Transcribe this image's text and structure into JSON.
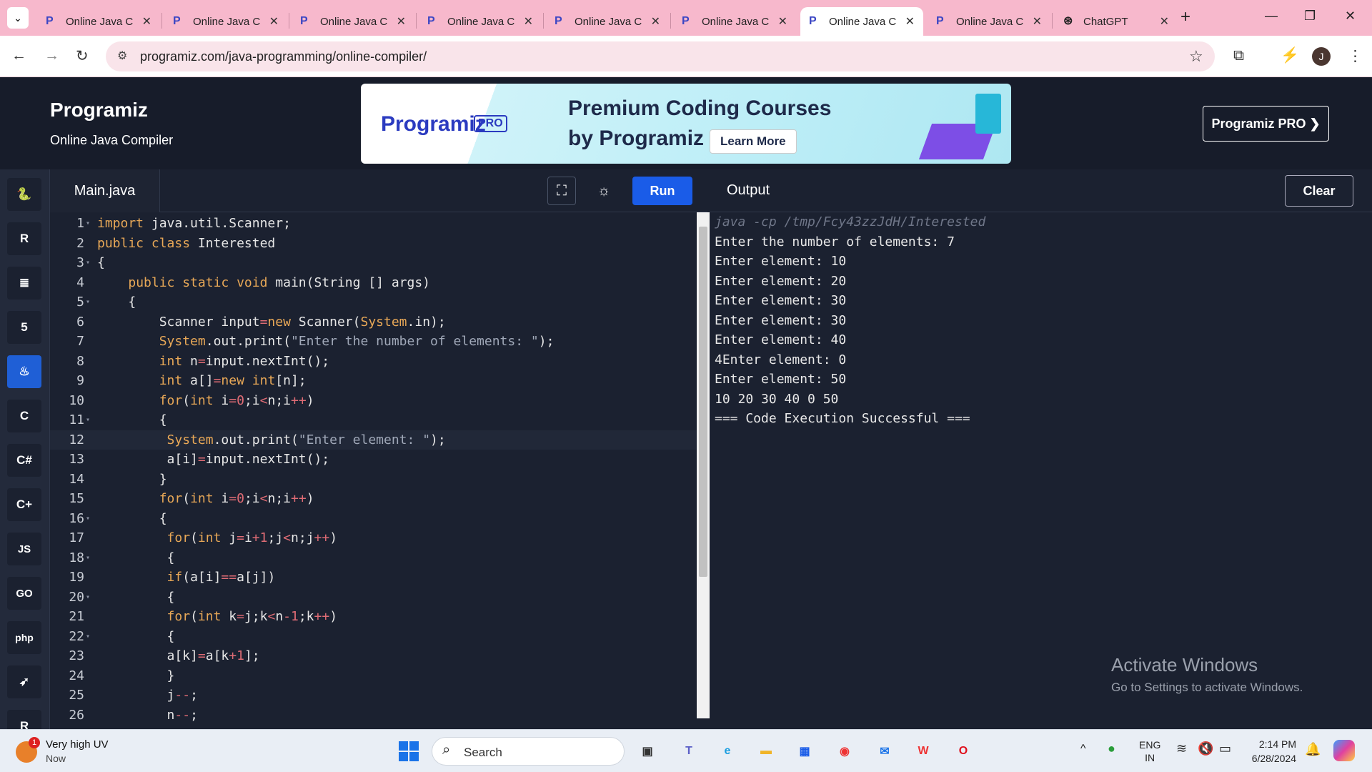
{
  "browser": {
    "tabs": [
      {
        "title": "Online Java C",
        "active": false
      },
      {
        "title": "Online Java C",
        "active": false
      },
      {
        "title": "Online Java C",
        "active": false
      },
      {
        "title": "Online Java C",
        "active": false
      },
      {
        "title": "Online Java C",
        "active": false
      },
      {
        "title": "Online Java C",
        "active": false
      },
      {
        "title": "Online Java C",
        "active": true
      },
      {
        "title": "Online Java C",
        "active": false
      },
      {
        "title": "ChatGPT",
        "active": false
      }
    ],
    "url": "programiz.com/java-programming/online-compiler/",
    "profile_initial": "J"
  },
  "site": {
    "logo": "Programiz",
    "subtitle": "Online Java Compiler",
    "banner": {
      "logo": "Programiz",
      "badge": "PRO",
      "line1": "Premium Coding Courses",
      "line2": "by Programiz",
      "cta": "Learn More"
    },
    "pro_button": "Programiz PRO ❯"
  },
  "sidebar": {
    "languages": [
      {
        "name": "python-icon",
        "glyph": "🐍",
        "active": false
      },
      {
        "name": "r-icon",
        "glyph": "R",
        "active": false
      },
      {
        "name": "sql-icon",
        "glyph": "≣",
        "active": false
      },
      {
        "name": "html-icon",
        "glyph": "5",
        "active": false
      },
      {
        "name": "java-icon",
        "glyph": "♨",
        "active": true
      },
      {
        "name": "c-icon",
        "glyph": "C",
        "active": false
      },
      {
        "name": "csharp-icon",
        "glyph": "C#",
        "active": false
      },
      {
        "name": "cpp-icon",
        "glyph": "C+",
        "active": false
      },
      {
        "name": "js-icon",
        "glyph": "JS",
        "active": false
      },
      {
        "name": "go-icon",
        "glyph": "GO",
        "active": false
      },
      {
        "name": "php-icon",
        "glyph": "php",
        "active": false
      },
      {
        "name": "swift-icon",
        "glyph": "➶",
        "active": false
      },
      {
        "name": "rust-icon",
        "glyph": "R",
        "active": false
      }
    ]
  },
  "editor": {
    "file_tab": "Main.java",
    "run_label": "Run",
    "current_line": 12,
    "lines": [
      {
        "n": "1",
        "fold": true,
        "html": "<span class='kw'>import</span> java.util.Scanner;"
      },
      {
        "n": "2",
        "fold": false,
        "html": "<span class='kw'>public class</span> Interested"
      },
      {
        "n": "3",
        "fold": true,
        "html": "{"
      },
      {
        "n": "4",
        "fold": false,
        "html": "    <span class='kw'>public static void</span> main(String [] args)"
      },
      {
        "n": "5",
        "fold": true,
        "html": "    {"
      },
      {
        "n": "6",
        "fold": false,
        "html": "        Scanner input<span class='op'>=</span><span class='kw'>new</span> Scanner(<span class='kw'>System</span>.in);"
      },
      {
        "n": "7",
        "fold": false,
        "html": "        <span class='kw'>System</span>.out.print(<span class='str'>\"Enter the number of elements: \"</span>);"
      },
      {
        "n": "8",
        "fold": false,
        "html": "        <span class='kw'>int</span> n<span class='op'>=</span>input.nextInt();"
      },
      {
        "n": "9",
        "fold": false,
        "html": "        <span class='kw'>int</span> a[]<span class='op'>=</span><span class='kw'>new int</span>[n];"
      },
      {
        "n": "10",
        "fold": false,
        "html": "        <span class='kw'>for</span>(<span class='kw'>int</span> i<span class='op'>=</span><span class='num'>0</span>;i<span class='op'>&lt;</span>n;i<span class='op'>++</span>)"
      },
      {
        "n": "11",
        "fold": true,
        "html": "        {"
      },
      {
        "n": "12",
        "fold": false,
        "html": "         <span class='kw'>System</span>.out.print(<span class='str'>\"Enter element: \"</span>);"
      },
      {
        "n": "13",
        "fold": false,
        "html": "         a[i]<span class='op'>=</span>input.nextInt();"
      },
      {
        "n": "14",
        "fold": false,
        "html": "        }"
      },
      {
        "n": "15",
        "fold": false,
        "html": "        <span class='kw'>for</span>(<span class='kw'>int</span> i<span class='op'>=</span><span class='num'>0</span>;i<span class='op'>&lt;</span>n;i<span class='op'>++</span>)"
      },
      {
        "n": "16",
        "fold": true,
        "html": "        {"
      },
      {
        "n": "17",
        "fold": false,
        "html": "         <span class='kw'>for</span>(<span class='kw'>int</span> j<span class='op'>=</span>i<span class='op'>+</span><span class='num'>1</span>;j<span class='op'>&lt;</span>n;j<span class='op'>++</span>)"
      },
      {
        "n": "18",
        "fold": true,
        "html": "         {"
      },
      {
        "n": "19",
        "fold": false,
        "html": "         <span class='kw'>if</span>(a[i]<span class='op'>==</span>a[j])"
      },
      {
        "n": "20",
        "fold": true,
        "html": "         {"
      },
      {
        "n": "21",
        "fold": false,
        "html": "         <span class='kw'>for</span>(<span class='kw'>int</span> k<span class='op'>=</span>j;k<span class='op'>&lt;</span>n<span class='op'>-</span><span class='num'>1</span>;k<span class='op'>++</span>)"
      },
      {
        "n": "22",
        "fold": true,
        "html": "         {"
      },
      {
        "n": "23",
        "fold": false,
        "html": "         a[k]<span class='op'>=</span>a[k<span class='op'>+</span><span class='num'>1</span>];"
      },
      {
        "n": "24",
        "fold": false,
        "html": "         }"
      },
      {
        "n": "25",
        "fold": false,
        "html": "         j<span class='op'>--</span>;"
      },
      {
        "n": "26",
        "fold": false,
        "html": "         n<span class='op'>--</span>;"
      }
    ]
  },
  "output": {
    "title": "Output",
    "clear_label": "Clear",
    "command": "java -cp /tmp/Fcy43zzJdH/Interested",
    "lines": [
      "Enter the number of elements: 7",
      "Enter element: 10",
      "Enter element: 20",
      "Enter element: 30",
      "Enter element: 30",
      "Enter element: 40",
      "4Enter element: 0",
      "Enter element: 50",
      "10 20 30 40 0 50",
      "=== Code Execution Successful ==="
    ],
    "watermark_title": "Activate Windows",
    "watermark_sub": "Go to Settings to activate Windows."
  },
  "taskbar": {
    "weather_title": "Very high UV",
    "weather_sub": "Now",
    "weather_badge": "1",
    "search_label": "Search",
    "lang_line1": "ENG",
    "lang_line2": "IN",
    "time": "2:14 PM",
    "date": "6/28/2024"
  }
}
